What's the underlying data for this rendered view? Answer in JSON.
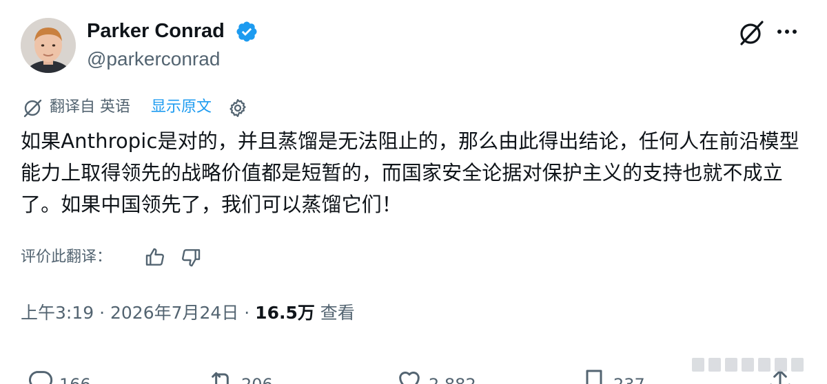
{
  "author": {
    "display_name": "Parker Conrad",
    "handle": "@parkerconrad"
  },
  "translation": {
    "translated_from": "翻译自 英语",
    "show_original": "显示原文"
  },
  "tweet": {
    "text": "如果Anthropic是对的，并且蒸馏是无法阻止的，那么由此得出结论，任何人在前沿模型能力上取得领先的战略价值都是短暂的，而国家安全论据对保护主义的支持也就不成立了。如果中国领先了，我们可以蒸馏它们！"
  },
  "rate": {
    "label": "评价此翻译："
  },
  "meta": {
    "time": "上午3:19",
    "sep1": " · ",
    "date": "2026年7月24日",
    "sep2": " · ",
    "views_count": "16.5万",
    "views_label": " 查看"
  },
  "actions": {
    "replies": "166",
    "retweets": "206",
    "likes": "2,882",
    "bookmarks": "237"
  },
  "colors": {
    "accent": "#1d9bf0",
    "secondary_text": "#536471",
    "primary_text": "#0f1419"
  },
  "icons": {
    "verified": "verified-badge-icon",
    "grok": "grok-icon",
    "more": "more-dots-icon",
    "translate": "translate-icon",
    "settings": "gear-icon",
    "thumbs_up": "thumbs-up-icon",
    "thumbs_down": "thumbs-down-icon",
    "reply": "reply-icon",
    "retweet": "retweet-icon",
    "like": "heart-icon",
    "bookmark": "bookmark-icon",
    "share": "share-icon"
  }
}
